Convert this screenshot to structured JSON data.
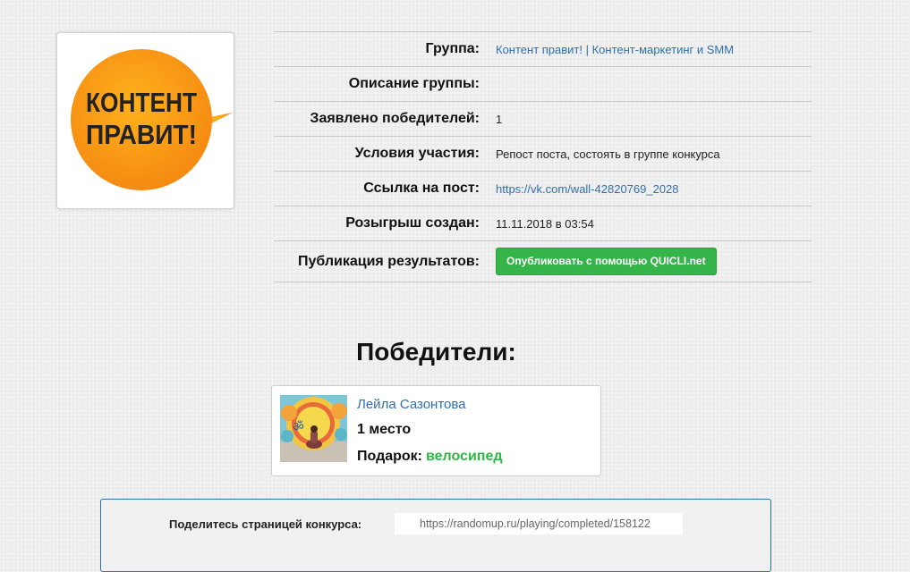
{
  "logo": {
    "line1": "КОНТЕНТ",
    "line2": "ПРАВИТ!",
    "bubble_color": "#f7941d"
  },
  "info": {
    "group_label": "Группа:",
    "group_value": "Контент правит! | Контент-маркетинг и SMM",
    "description_label": "Описание группы:",
    "description_value": "",
    "winners_declared_label": "Заявлено победителей:",
    "winners_declared_value": "1",
    "conditions_label": "Условия участия:",
    "conditions_value": "Репост поста, состоять в группе конкурса",
    "post_link_label": "Ссылка на пост:",
    "post_link_value": "https://vk.com/wall-42820769_2028",
    "created_label": "Розыгрыш создан:",
    "created_value": "11.11.2018 в 03:54",
    "publish_label": "Публикация результатов:",
    "publish_button": "Опубликовать с помощью QUICLI.net"
  },
  "winners": {
    "title": "Победители:",
    "items": [
      {
        "name": "Лейла Сазонтова",
        "place": "1 место",
        "prize_label": "Подарок:",
        "prize": "велосипед"
      }
    ]
  },
  "share": {
    "label": "Поделитесь страницей конкурса:",
    "url": "https://randomup.ru/playing/completed/158122"
  },
  "colors": {
    "link": "#2f6fad",
    "button_green": "#35b44a",
    "prize_green": "#2db843",
    "share_border": "#2f6fad"
  }
}
